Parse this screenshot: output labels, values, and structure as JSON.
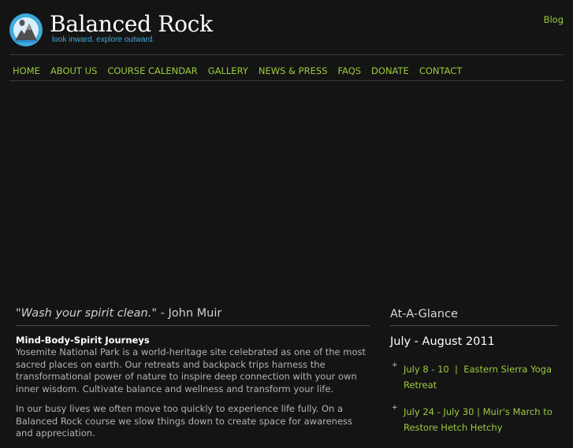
{
  "header": {
    "brand_name": "Balanced Rock",
    "tagline": "look inward. explore outward.",
    "blog_link": "Blog"
  },
  "nav": [
    {
      "label": "HOME"
    },
    {
      "label": "ABOUT US"
    },
    {
      "label": "COURSE CALENDAR"
    },
    {
      "label": "GALLERY"
    },
    {
      "label": "NEWS & PRESS"
    },
    {
      "label": "FAQS"
    },
    {
      "label": "DONATE"
    },
    {
      "label": "CONTACT"
    }
  ],
  "main": {
    "quote_open": "\"",
    "quote_text": "Wash your spirit clean.",
    "quote_close": "\" - John Muir",
    "intro_heading": "Mind-Body-Spirit Journeys",
    "paragraph_1": "Yosemite National Park is a world-heritage site celebrated as one of the most sacred places on earth. Our retreats and backpack trips harness the transformational power of nature to inspire deep connection with your own inner wisdom. Cultivate balance and wellness and transform your life.",
    "paragraph_2": "In our busy lives we often move too quickly to experience life fully. On a Balanced Rock course we slow things down to create space for awareness and appreciation."
  },
  "sidebar": {
    "heading": "At-A-Glance",
    "month": "July - August 2011",
    "bullet": "+",
    "events": [
      {
        "label": "July 8 - 10  |  Eastern Sierra Yoga Retreat"
      },
      {
        "label": "July 24 - July 30 | Muir's March to Restore Hetch Hetchy"
      }
    ]
  },
  "colors": {
    "background": "#141414",
    "link_green": "#9bcb3d",
    "tagline_blue": "#3fa9dc",
    "logo_blue": "#2d8fcf"
  }
}
